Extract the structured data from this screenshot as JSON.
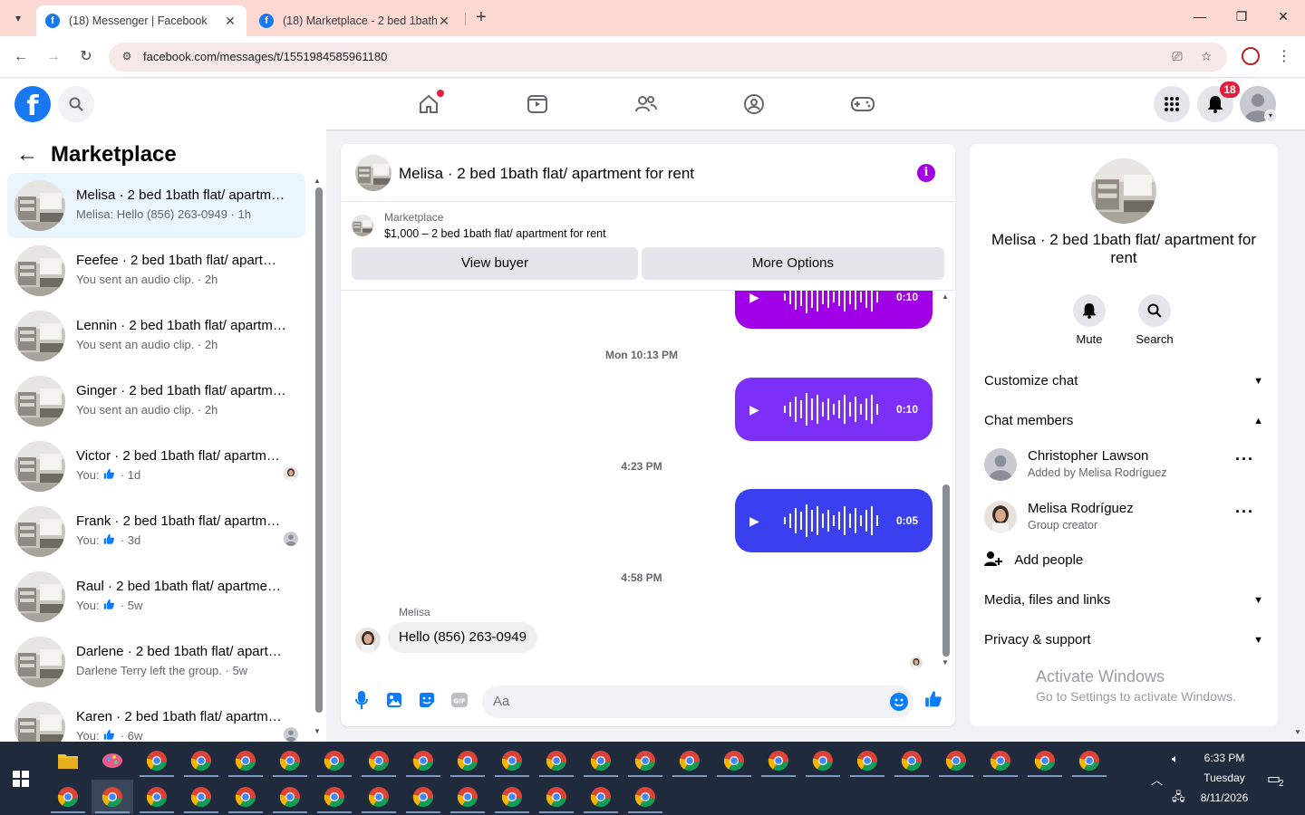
{
  "browser": {
    "tabs": [
      {
        "title": "(18) Messenger | Facebook",
        "active": true
      },
      {
        "title": "(18) Marketplace - 2 bed 1bath",
        "active": false
      }
    ],
    "url": "facebook.com/messages/t/1551984585961180"
  },
  "fbnav": {
    "notification_count": "18",
    "icons": [
      "home-icon",
      "reels-icon",
      "friends-icon",
      "groups-icon",
      "gaming-icon"
    ]
  },
  "left": {
    "title": "Marketplace",
    "conversations": [
      {
        "name": "Melisa · 2 bed 1bath flat/ apartment for rent",
        "preview": "Melisa: Hello (856) 263-0949 · 1h",
        "selected": true
      },
      {
        "name": "Feefee · 2 bed 1bath flat/ apartment for rent",
        "preview": "You sent an audio clip. · 2h"
      },
      {
        "name": "Lennin · 2 bed 1bath flat/ apartment for rent",
        "preview": "You sent an audio clip. · 2h"
      },
      {
        "name": "Ginger · 2 bed 1bath flat/ apartment for rent",
        "preview": "You sent an audio clip. · 2h"
      },
      {
        "name": "Victor · 2 bed 1bath flat/ apartment for rent",
        "preview_prefix": "You:",
        "preview_suffix": "· 1d"
      },
      {
        "name": "Frank · 2 bed 1bath flat/ apartment for rent",
        "preview_prefix": "You:",
        "preview_suffix": "· 3d"
      },
      {
        "name": "Raul · 2 bed 1bath flat/ apartment for rent",
        "preview_prefix": "You:",
        "preview_suffix": "· 5w"
      },
      {
        "name": "Darlene · 2 bed 1bath flat/ apartment for rent",
        "preview": "Darlene Terry left the group. · 5w"
      },
      {
        "name": "Karen · 2 bed 1bath flat/ apartment for rent",
        "preview_prefix": "You:",
        "preview_suffix": "· 6w"
      }
    ]
  },
  "chat": {
    "title": "Melisa · 2 bed 1bath flat/ apartment for rent",
    "marketplace_label": "Marketplace",
    "listing": "$1,000 – 2 bed 1bath flat/ apartment for rent",
    "view_buyer": "View buyer",
    "more_options": "More Options",
    "messages": {
      "audio1_duration": "0:10",
      "ts1": "Mon 10:13 PM",
      "audio2_duration": "0:10",
      "ts2": "4:23 PM",
      "audio3_duration": "0:05",
      "ts3": "4:58 PM",
      "sender": "Melisa",
      "incoming_text": "Hello (856) 263-0949"
    },
    "composer_placeholder": "Aa",
    "colors": {
      "audio_top": "#a000e6",
      "audio_mid": "#7b2ff7",
      "audio_bottom": "#3a3ff0",
      "accent": "#0a7cff"
    }
  },
  "right": {
    "name": "Melisa · 2 bed 1bath flat/ apartment for rent",
    "mute": "Mute",
    "search": "Search",
    "customize": "Customize chat",
    "members_label": "Chat members",
    "members": [
      {
        "name": "Christopher Lawson",
        "role": "Added by Melisa Rodríguez"
      },
      {
        "name": "Melisa Rodríguez",
        "role": "Group creator"
      }
    ],
    "add_people": "Add people",
    "media": "Media, files and links",
    "privacy": "Privacy & support"
  },
  "watermark": {
    "line1": "Activate Windows",
    "line2": "Go to Settings to activate Windows."
  },
  "taskbar": {
    "time": "6:33 PM",
    "day": "Tuesday",
    "date": "8/11/2026",
    "notif_count": "2"
  }
}
